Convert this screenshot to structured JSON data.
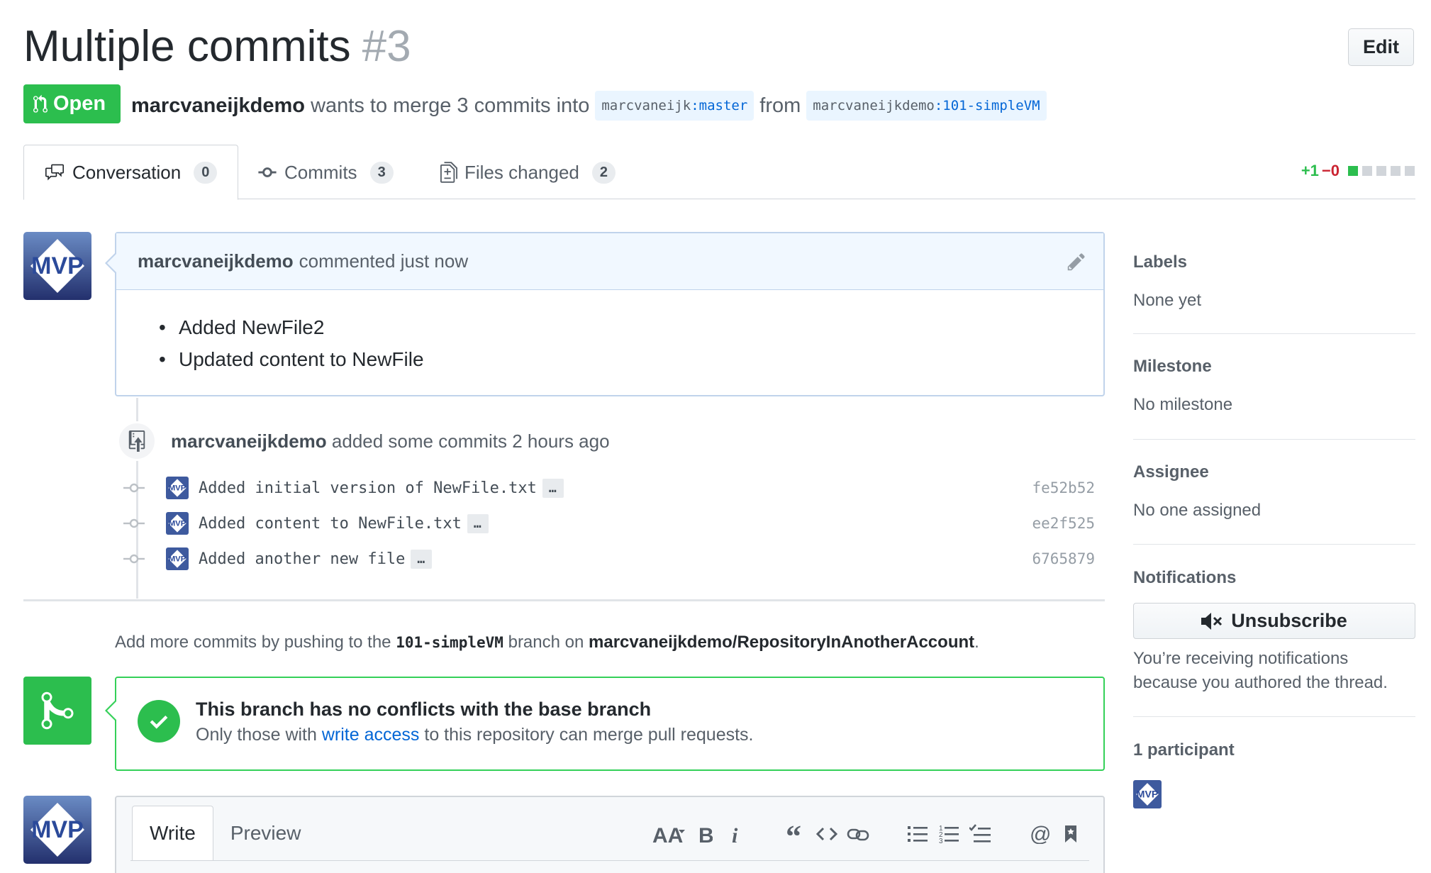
{
  "pr": {
    "title": "Multiple commits",
    "number": "#3",
    "edit_label": "Edit",
    "state": "Open",
    "author": "marcvaneijkdemo",
    "merge_text": "wants to merge 3 commits into",
    "base_owner": "marcvaneijk",
    "base_branch": ":master",
    "from_text": "from",
    "head_owner": "marcvaneijkdemo",
    "head_branch": ":101-simpleVM"
  },
  "tabs": [
    {
      "label": "Conversation",
      "count": "0",
      "icon": "comment-discussion-icon"
    },
    {
      "label": "Commits",
      "count": "3",
      "icon": "git-commit-icon"
    },
    {
      "label": "Files changed",
      "count": "2",
      "icon": "file-diff-icon"
    }
  ],
  "diffstat": {
    "additions": "+1",
    "deletions": "−0",
    "colors": {
      "add": "#2cbe4e",
      "del": "#cb2431",
      "neutral": "#d1d5da"
    }
  },
  "comment": {
    "author": "marcvaneijkdemo",
    "action": "commented just now",
    "items": [
      "Added NewFile2",
      "Updated content to NewFile"
    ]
  },
  "push_event": {
    "author": "marcvaneijkdemo",
    "text": "added some commits 2 hours ago"
  },
  "commits": [
    {
      "message": "Added initial version of NewFile.txt",
      "sha": "fe52b52"
    },
    {
      "message": "Added content to NewFile.txt",
      "sha": "ee2f525"
    },
    {
      "message": "Added another new file",
      "sha": "6765879"
    }
  ],
  "commit_ellipsis": "…",
  "hint": {
    "prefix": "Add more commits by pushing to the",
    "branch": "101-simpleVM",
    "middle": "branch on",
    "repo": "marcvaneijkdemo/RepositoryInAnotherAccount",
    "suffix": "."
  },
  "merge": {
    "title": "This branch has no conflicts with the base branch",
    "sub_prefix": "Only those with",
    "sub_link": "write access",
    "sub_suffix": "to this repository can merge pull requests."
  },
  "editor": {
    "write_tab": "Write",
    "preview_tab": "Preview"
  },
  "sidebar": {
    "labels_h": "Labels",
    "labels_v": "None yet",
    "milestone_h": "Milestone",
    "milestone_v": "No milestone",
    "assignee_h": "Assignee",
    "assignee_v": "No one assigned",
    "notifications_h": "Notifications",
    "unsubscribe": "Unsubscribe",
    "notif_reason": "You’re receiving notifications because you authored the thread.",
    "participants_h": "1 participant"
  },
  "avatar_text": "MVP",
  "colors": {
    "brand_green": "#2cbe4e",
    "link_blue": "#0366d6"
  }
}
